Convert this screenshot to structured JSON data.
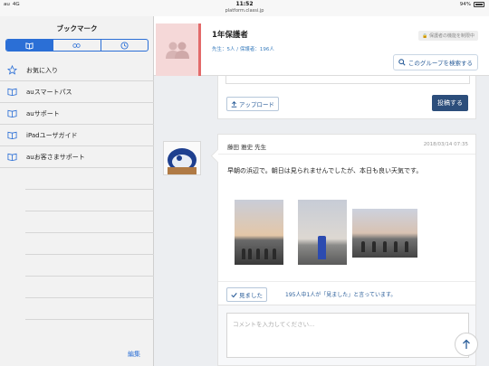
{
  "status_bar": {
    "carrier": "au",
    "network": "4G",
    "time": "11:52",
    "url": "platform.classi.jp",
    "battery": "94%"
  },
  "sidebar": {
    "title": "ブックマーク",
    "segments": [
      {
        "icon": "book-icon"
      },
      {
        "icon": "glasses-icon"
      },
      {
        "icon": "clock-icon"
      }
    ],
    "items": [
      {
        "label": "お気に入り",
        "icon": "star-icon"
      },
      {
        "label": "auスマートパス",
        "icon": "book-icon"
      },
      {
        "label": "auサポート",
        "icon": "book-icon"
      },
      {
        "label": "iPadユーザガイド",
        "icon": "book-icon"
      },
      {
        "label": "auお客さまサポート",
        "icon": "book-icon"
      }
    ],
    "edit_label": "編集"
  },
  "header": {
    "group_title": "1年保護者",
    "meta": "先生：5人 / 保護者：196人",
    "restriction_badge": "保護者の機能を制限中",
    "search_button": "このグループを検索する"
  },
  "composer": {
    "upload_label": "アップロード",
    "post_label": "投稿する"
  },
  "post": {
    "author": "藤田 雅史 先生",
    "date": "2018/03/14 07:35",
    "body": "早朝の浜辺で。朝日は見られませんでしたが、本日も良い天気です。",
    "seen_button": "見ました",
    "seen_text": "195人中1人が「見ました」と言っています。"
  },
  "comment": {
    "placeholder": "コメントを入力してください..."
  },
  "colors": {
    "accent": "#2b6fd6",
    "post_button": "#2c4e7b",
    "group_accent": "#e36a6a"
  }
}
